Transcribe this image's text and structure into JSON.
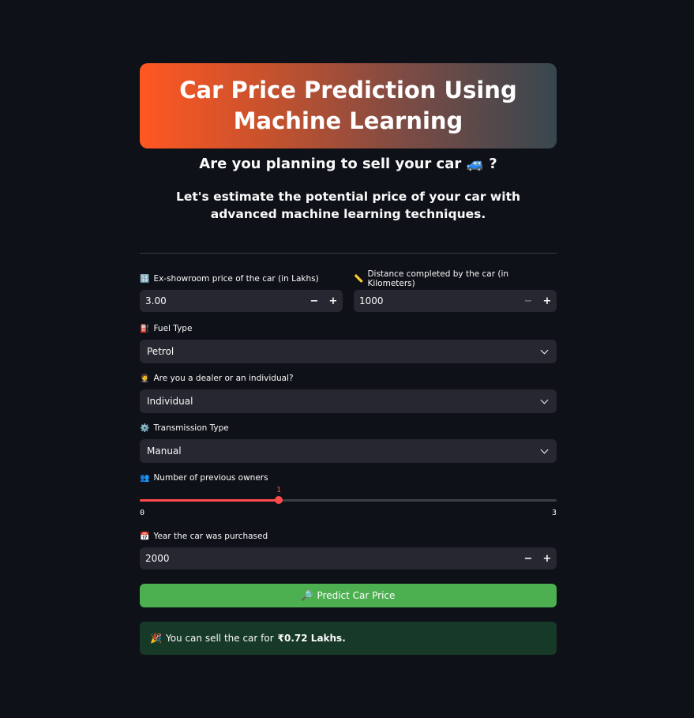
{
  "header": {
    "title": "Car Price Prediction Using Machine Learning",
    "subtitle": "Are you planning to sell your car",
    "subtitle_emoji": "🚙",
    "subtitle_end": "?",
    "tagline": "Let's estimate the potential price of your car with advanced machine learning techniques."
  },
  "form": {
    "ex_showroom": {
      "icon": "🔢",
      "icon_name": "numbers-icon",
      "label": "Ex-showroom price of the car (in Lakhs)",
      "value": "3.00",
      "minus": "−",
      "plus": "+"
    },
    "distance": {
      "icon": "📏",
      "icon_name": "ruler-icon",
      "label": "Distance completed by the car (in Kilometers)",
      "value": "1000",
      "minus": "−",
      "plus": "+"
    },
    "fuel": {
      "icon": "⛽",
      "icon_name": "fuel-pump-icon",
      "label": "Fuel Type",
      "value": "Petrol"
    },
    "seller": {
      "icon": "🤵",
      "icon_name": "person-icon",
      "label": "Are you a dealer or an individual?",
      "value": "Individual"
    },
    "transmission": {
      "icon": "⚙️",
      "icon_name": "gear-icon",
      "label": "Transmission Type",
      "value": "Manual"
    },
    "owners": {
      "icon": "👥",
      "icon_name": "people-icon",
      "label": "Number of previous owners",
      "value": "1",
      "min": "0",
      "max": "3",
      "fraction": 0.3333
    },
    "year": {
      "icon": "📅",
      "icon_name": "calendar-icon",
      "label": "Year the car was purchased",
      "value": "2000",
      "minus": "−",
      "plus": "+"
    }
  },
  "predict_button": {
    "icon": "🔎",
    "label": "Predict Car Price"
  },
  "result": {
    "icon": "🎉",
    "text": "You can sell the car for",
    "amount": "₹0.72 Lakhs."
  },
  "colors": {
    "background": "#0e1117",
    "input_bg": "#262730",
    "accent": "#ff4b4b",
    "button": "#4caf50",
    "success_bg": "#173928"
  }
}
